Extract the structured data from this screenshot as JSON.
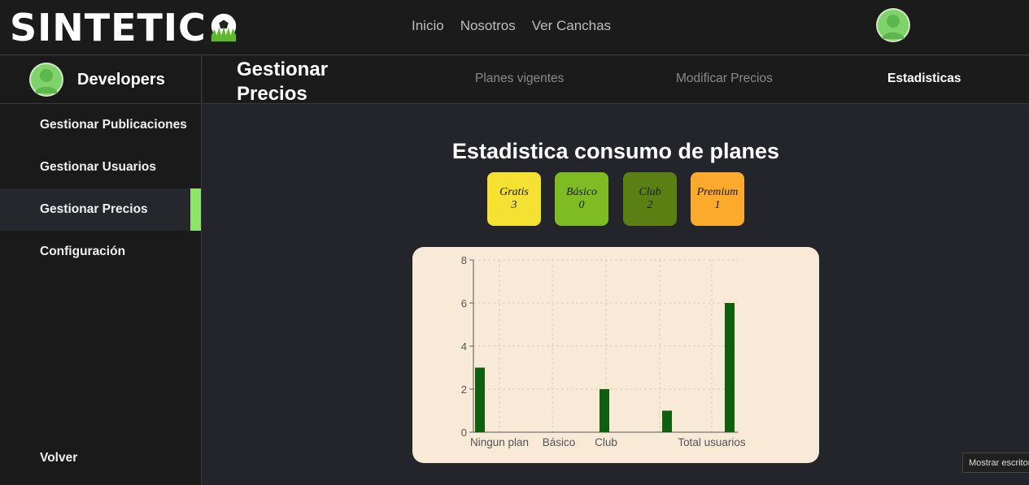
{
  "app": {
    "logo_text": "SINTETIC"
  },
  "topnav": {
    "items": [
      "Inicio",
      "Nosotros",
      "Ver Canchas"
    ]
  },
  "sidebar": {
    "user_name": "Developers",
    "items": [
      {
        "label": "Gestionar Publicaciones",
        "active": false
      },
      {
        "label": "Gestionar Usuarios",
        "active": false
      },
      {
        "label": "Gestionar Precios",
        "active": true
      },
      {
        "label": "Configuración",
        "active": false
      }
    ],
    "back_label": "Volver"
  },
  "subheader": {
    "title": "Gestionar Precios",
    "tabs": [
      {
        "label": "Planes vigentes",
        "active": false
      },
      {
        "label": "Modificar Precios",
        "active": false
      },
      {
        "label": "Estadisticas",
        "active": true
      }
    ]
  },
  "stats": {
    "title": "Estadistica consumo de planes",
    "plans": [
      {
        "name": "Gratis",
        "count": "3",
        "color": "#f4e132"
      },
      {
        "name": "Básico",
        "count": "0",
        "color": "#7fbb22"
      },
      {
        "name": "Club",
        "count": "2",
        "color": "#5a7f12"
      },
      {
        "name": "Premium",
        "count": "1",
        "color": "#fbaa2c"
      }
    ]
  },
  "chart_data": {
    "type": "bar",
    "x_ticks": [
      "Ningun plan",
      "Básico",
      "Club",
      "Total usuarios"
    ],
    "bars": [
      {
        "x": 0,
        "value": 3
      },
      {
        "x": 2,
        "value": 2
      },
      {
        "x": 3,
        "value": 1
      },
      {
        "x": 4,
        "value": 6
      }
    ],
    "ylim": [
      0,
      8
    ],
    "yticks": [
      0,
      2,
      4,
      6,
      8
    ],
    "grid": true,
    "bar_color": "#0f5f0f"
  },
  "tooltip": {
    "text": "Mostrar escritorio"
  }
}
